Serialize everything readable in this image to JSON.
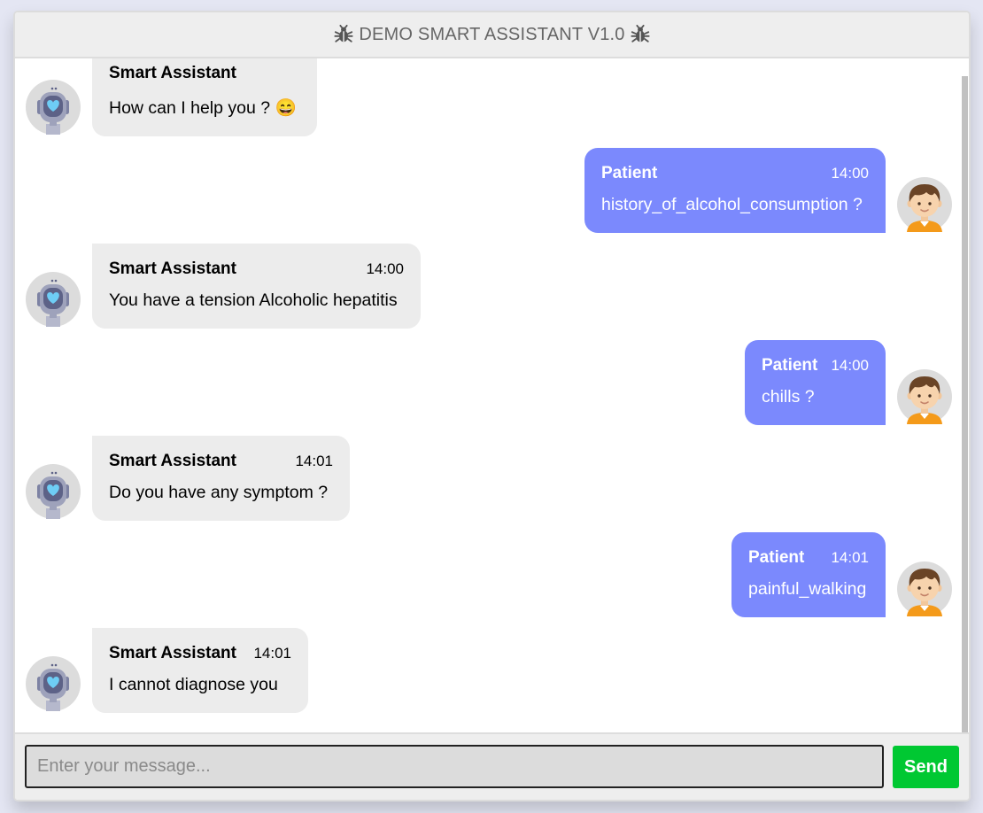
{
  "header": {
    "title": "DEMO SMART ASSISTANT V1.0",
    "icon": "bug-icon"
  },
  "messages": [
    {
      "sender": "Smart Assistant",
      "role": "bot",
      "time": "",
      "text": "How can I help you ? 😄"
    },
    {
      "sender": "Patient",
      "role": "user",
      "time": "14:00",
      "text": "history_of_alcohol_consumption ?"
    },
    {
      "sender": "Smart Assistant",
      "role": "bot",
      "time": "14:00",
      "text": "You have a tension Alcoholic hepatitis"
    },
    {
      "sender": "Patient",
      "role": "user",
      "time": "14:00",
      "text": "chills ?"
    },
    {
      "sender": "Smart Assistant",
      "role": "bot",
      "time": "14:01",
      "text": "Do you have any symptom ?"
    },
    {
      "sender": "Patient",
      "role": "user",
      "time": "14:01",
      "text": "painful_walking"
    },
    {
      "sender": "Smart Assistant",
      "role": "bot",
      "time": "14:01",
      "text": "I cannot diagnose you"
    }
  ],
  "composer": {
    "placeholder": "Enter your message...",
    "value": "",
    "send_label": "Send"
  },
  "colors": {
    "user_bubble": "#7b89fd",
    "bot_bubble": "#ececec",
    "send_button": "#00c832"
  }
}
